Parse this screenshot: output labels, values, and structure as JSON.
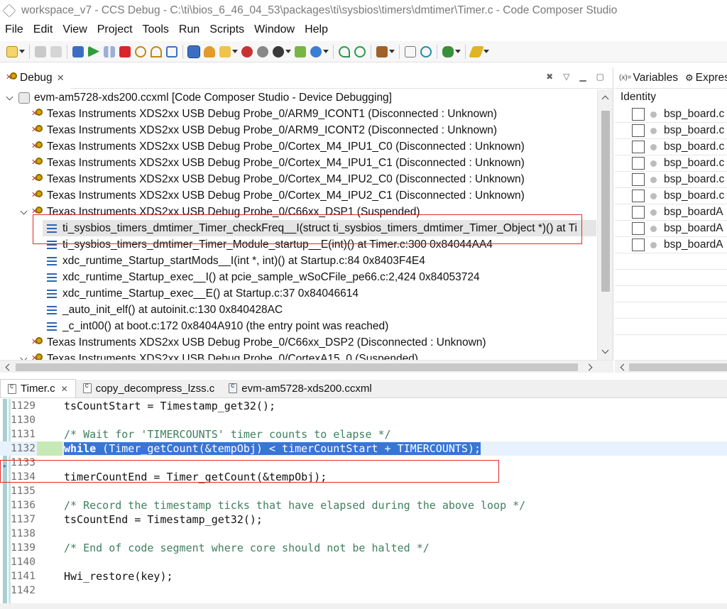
{
  "window": {
    "title": "workspace_v7 - CCS Debug - C:\\ti\\bios_6_46_04_53\\packages\\ti\\sysbios\\timers\\dmtimer\\Timer.c - Code Composer Studio"
  },
  "menu": [
    "File",
    "Edit",
    "View",
    "Project",
    "Tools",
    "Run",
    "Scripts",
    "Window",
    "Help"
  ],
  "debug": {
    "tab_label": "Debug",
    "tab_close": "✕",
    "tree": [
      {
        "kind": "config",
        "label": "evm-am5728-xds200.ccxml [Code Composer Studio - Device Debugging]"
      },
      {
        "kind": "probe",
        "label": "Texas Instruments XDS2xx USB Debug Probe_0/ARM9_ICONT1 (Disconnected : Unknown)"
      },
      {
        "kind": "probe",
        "label": "Texas Instruments XDS2xx USB Debug Probe_0/ARM9_ICONT2 (Disconnected : Unknown)"
      },
      {
        "kind": "probe",
        "label": "Texas Instruments XDS2xx USB Debug Probe_0/Cortex_M4_IPU1_C0 (Disconnected : Unknown)"
      },
      {
        "kind": "probe",
        "label": "Texas Instruments XDS2xx USB Debug Probe_0/Cortex_M4_IPU1_C1 (Disconnected : Unknown)"
      },
      {
        "kind": "probe",
        "label": "Texas Instruments XDS2xx USB Debug Probe_0/Cortex_M4_IPU2_C0 (Disconnected : Unknown)"
      },
      {
        "kind": "probe",
        "label": "Texas Instruments XDS2xx USB Debug Probe_0/Cortex_M4_IPU2_C1 (Disconnected : Unknown)"
      },
      {
        "kind": "probe-open",
        "label": "Texas Instruments XDS2xx USB Debug Probe_0/C66xx_DSP1 (Suspended)"
      },
      {
        "kind": "frame-selected",
        "label": "ti_sysbios_timers_dmtimer_Timer_checkFreq__I(struct ti_sysbios_timers_dmtimer_Timer_Object *)() at Ti"
      },
      {
        "kind": "frame",
        "label": "ti_sysbios_timers_dmtimer_Timer_Module_startup__E(int)() at Timer.c:300 0x84044AA4"
      },
      {
        "kind": "frame",
        "label": "xdc_runtime_Startup_startMods__I(int *, int)() at Startup.c:84 0x8403F4E4"
      },
      {
        "kind": "frame",
        "label": "xdc_runtime_Startup_exec__I() at pcie_sample_wSoCFile_pe66.c:2,424 0x84053724"
      },
      {
        "kind": "frame",
        "label": "xdc_runtime_Startup_exec__E() at Startup.c:37 0x84046614"
      },
      {
        "kind": "frame",
        "label": "_auto_init_elf() at autoinit.c:130 0x840428AC"
      },
      {
        "kind": "frame",
        "label": "_c_int00() at boot.c:172 0x8404A910  (the entry point was reached)"
      },
      {
        "kind": "probe",
        "label": "Texas Instruments XDS2xx USB Debug Probe_0/C66xx_DSP2 (Disconnected : Unknown)"
      },
      {
        "kind": "probe-open",
        "label": "Texas Instruments XDS2xx USB Debug Probe_0/CortexA15_0 (Suspended)"
      }
    ]
  },
  "variables": {
    "tab_vars": "Variables",
    "tab_expr": "Expres",
    "xy_glyph": "(x)=",
    "header": "Identity",
    "rows": [
      "bsp_board.c",
      "bsp_board.c",
      "bsp_board.c",
      "bsp_board.c",
      "bsp_board.c",
      "bsp_board.c",
      "bsp_boardA",
      "bsp_boardA",
      "bsp_boardA"
    ]
  },
  "editor": {
    "tabs": [
      {
        "label": "Timer.c",
        "close": "✕"
      },
      {
        "label": "copy_decompress_lzss.c"
      },
      {
        "label": "evm-am5728-xds200.ccxml"
      }
    ],
    "lines": [
      {
        "num": "1129",
        "code": "tsCountStart = Timestamp_get32();"
      },
      {
        "num": "1130",
        "code": ""
      },
      {
        "num": "1131",
        "code": "/* Wait for 'TIMERCOUNTS' timer counts to elapse */"
      },
      {
        "num": "1132",
        "kw": "while",
        "code": " (Timer_getCount(&tempObj) < timerCountStart + TIMERCOUNTS);"
      },
      {
        "num": "1133",
        "code": ""
      },
      {
        "num": "1134",
        "code": "timerCountEnd = Timer_getCount(&tempObj);"
      },
      {
        "num": "1135",
        "code": ""
      },
      {
        "num": "1136",
        "code": "/* Record the timestamp ticks that have elapsed during the above loop */"
      },
      {
        "num": "1137",
        "code": "tsCountEnd = Timestamp_get32();"
      },
      {
        "num": "1138",
        "code": ""
      },
      {
        "num": "1139",
        "code": "/* End of code segment where core should not be halted */"
      },
      {
        "num": "1140",
        "code": ""
      },
      {
        "num": "1141",
        "code": "Hwi_restore(key);"
      },
      {
        "num": "1142",
        "code": ""
      }
    ]
  },
  "colors": {
    "selection_box": "#e02b2b",
    "code_selection": "#3875d7",
    "current_line": "#e8f2fe"
  }
}
